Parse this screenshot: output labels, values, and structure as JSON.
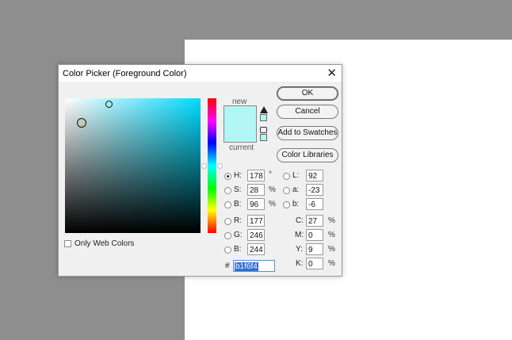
{
  "dialog": {
    "title": "Color Picker (Foreground Color)",
    "close": "✕"
  },
  "preview": {
    "new_label": "new",
    "current_label": "current",
    "new_color": "#b1f6f4",
    "current_color": "#b1f6f4"
  },
  "buttons": {
    "ok": "OK",
    "cancel": "Cancel",
    "add_to_swatches": "Add to Swatches",
    "color_libraries": "Color Libraries"
  },
  "hsb": {
    "h": {
      "label": "H:",
      "value": "178",
      "unit": "°"
    },
    "s": {
      "label": "S:",
      "value": "28",
      "unit": "%"
    },
    "b": {
      "label": "B:",
      "value": "96",
      "unit": "%"
    }
  },
  "rgb": {
    "r": {
      "label": "R:",
      "value": "177"
    },
    "g": {
      "label": "G:",
      "value": "246"
    },
    "b": {
      "label": "B:",
      "value": "244"
    }
  },
  "lab": {
    "l": {
      "label": "L:",
      "value": "92"
    },
    "a": {
      "label": "a:",
      "value": "-23"
    },
    "b": {
      "label": "b:",
      "value": "-6"
    }
  },
  "cmyk": {
    "c": {
      "label": "C:",
      "value": "27",
      "unit": "%"
    },
    "m": {
      "label": "M:",
      "value": "0",
      "unit": "%"
    },
    "y": {
      "label": "Y:",
      "value": "9",
      "unit": "%"
    },
    "k": {
      "label": "K:",
      "value": "0",
      "unit": "%"
    }
  },
  "hex": {
    "label": "#",
    "value": "b1f6f4"
  },
  "only_web_colors": {
    "label": "Only Web Colors",
    "checked": false
  },
  "selected_mode": "H",
  "colors": {
    "accent_selection": "#2f6fd1",
    "hue_base": "#00dcff"
  }
}
